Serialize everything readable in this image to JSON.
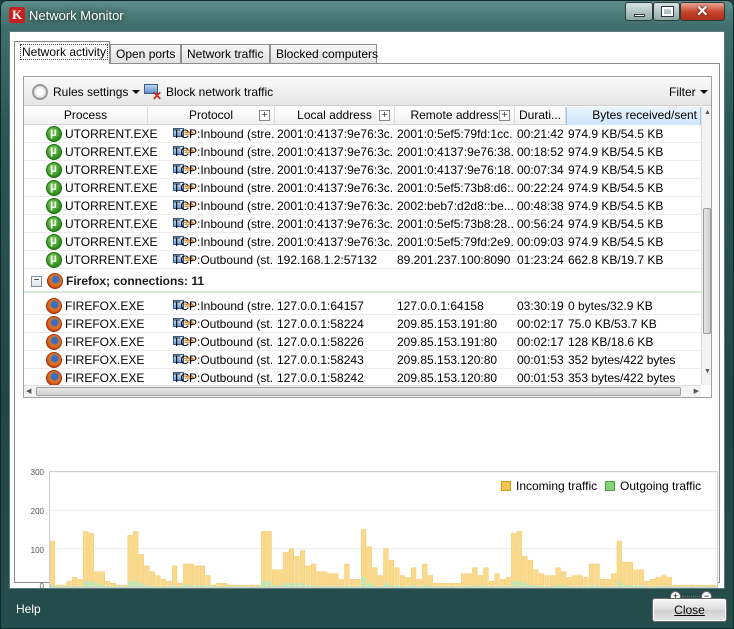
{
  "window": {
    "title": "Network Monitor"
  },
  "tabs": [
    {
      "label": "Network activity",
      "active": true
    },
    {
      "label": "Open ports",
      "active": false
    },
    {
      "label": "Network traffic",
      "active": false
    },
    {
      "label": "Blocked computers",
      "active": false
    }
  ],
  "toolbar": {
    "rules_settings": "Rules settings",
    "block_traffic": "Block network traffic",
    "filter": "Filter"
  },
  "table": {
    "columns": [
      "Process",
      "Protocol",
      "Local address",
      "Remote address",
      "Durati...",
      "Bytes received/sent"
    ],
    "rows_utorrent": [
      {
        "process": "UTORRENT.EXE",
        "protocol": "TCP:Inbound (stre...",
        "local": "2001:0:4137:9e76:3c...",
        "remote": "2001:0:5ef5:79fd:1cc...",
        "duration": "00:21:42",
        "bytes": "974.9 KB/54.5 KB"
      },
      {
        "process": "UTORRENT.EXE",
        "protocol": "TCP:Inbound (stre...",
        "local": "2001:0:4137:9e76:3c...",
        "remote": "2001:0:4137:9e76:38...",
        "duration": "00:18:52",
        "bytes": "974.9 KB/54.5 KB"
      },
      {
        "process": "UTORRENT.EXE",
        "protocol": "TCP:Inbound (stre...",
        "local": "2001:0:4137:9e76:3c...",
        "remote": "2001:0:4137:9e76:18...",
        "duration": "00:07:34",
        "bytes": "974.9 KB/54.5 KB"
      },
      {
        "process": "UTORRENT.EXE",
        "protocol": "TCP:Inbound (stre...",
        "local": "2001:0:4137:9e76:3c...",
        "remote": "2001:0:5ef5:73b8:d6:...",
        "duration": "00:22:24",
        "bytes": "974.9 KB/54.5 KB"
      },
      {
        "process": "UTORRENT.EXE",
        "protocol": "TCP:Inbound (stre...",
        "local": "2001:0:4137:9e76:3c...",
        "remote": "2002:beb7:d2d8::be...",
        "duration": "00:48:38",
        "bytes": "974.9 KB/54.5 KB"
      },
      {
        "process": "UTORRENT.EXE",
        "protocol": "TCP:Inbound (stre...",
        "local": "2001:0:4137:9e76:3c...",
        "remote": "2001:0:5ef5:73b8:28...",
        "duration": "00:56:24",
        "bytes": "974.9 KB/54.5 KB"
      },
      {
        "process": "UTORRENT.EXE",
        "protocol": "TCP:Inbound (stre...",
        "local": "2001:0:4137:9e76:3c...",
        "remote": "2001:0:5ef5:79fd:2e9...",
        "duration": "00:09:03",
        "bytes": "974.9 KB/54.5 KB"
      },
      {
        "process": "UTORRENT.EXE",
        "protocol": "TCP:Outbound (st...",
        "local": "192.168.1.2:57132",
        "remote": "89.201.237.100:8090",
        "duration": "01:23:24",
        "bytes": "662.8 KB/19.7 KB"
      }
    ],
    "group_firefox": "Firefox; connections: 11",
    "rows_firefox": [
      {
        "process": "FIREFOX.EXE",
        "protocol": "TCP:Inbound (stre...",
        "local": "127.0.0.1:64157",
        "remote": "127.0.0.1:64158",
        "duration": "03:30:19",
        "bytes": "0 bytes/32.9 KB"
      },
      {
        "process": "FIREFOX.EXE",
        "protocol": "TCP:Outbound (st...",
        "local": "127.0.0.1:58224",
        "remote": "209.85.153.191:80",
        "duration": "00:02:17",
        "bytes": "75.0 KB/53.7 KB"
      },
      {
        "process": "FIREFOX.EXE",
        "protocol": "TCP:Outbound (st...",
        "local": "127.0.0.1:58226",
        "remote": "209.85.153.191:80",
        "duration": "00:02:17",
        "bytes": "128 KB/18.6 KB"
      },
      {
        "process": "FIREFOX.EXE",
        "protocol": "TCP:Outbound (st...",
        "local": "127.0.0.1:58243",
        "remote": "209.85.153.120:80",
        "duration": "00:01:53",
        "bytes": "352 bytes/422 bytes"
      },
      {
        "process": "FIREFOX.EXE",
        "protocol": "TCP:Outbound (st...",
        "local": "127.0.0.1:58242",
        "remote": "209.85.153.120:80",
        "duration": "00:01:53",
        "bytes": "353 bytes/422 bytes"
      }
    ]
  },
  "chart_data": {
    "type": "bar",
    "yticks": [
      "300",
      "200",
      "100",
      "0"
    ],
    "ylim": [
      0,
      300
    ],
    "series": [
      {
        "name": "Incoming traffic",
        "color": "#f5c451",
        "values": [
          120,
          5,
          5,
          15,
          25,
          20,
          145,
          140,
          40,
          40,
          15,
          10,
          5,
          5,
          135,
          145,
          85,
          55,
          40,
          30,
          20,
          15,
          55,
          10,
          60,
          60,
          55,
          55,
          30,
          5,
          10,
          10,
          5,
          5,
          5,
          5,
          5,
          5,
          145,
          145,
          45,
          45,
          90,
          100,
          80,
          95,
          55,
          60,
          40,
          40,
          35,
          35,
          20,
          60,
          20,
          20,
          150,
          105,
          50,
          30,
          100,
          70,
          50,
          30,
          25,
          50,
          20,
          60,
          30,
          10,
          10,
          10,
          10,
          10,
          35,
          35,
          50,
          30,
          50,
          15,
          35,
          20,
          25,
          140,
          145,
          80,
          70,
          45,
          35,
          30,
          30,
          50,
          40,
          25,
          30,
          30,
          25,
          60,
          60,
          20,
          20,
          35,
          120,
          65,
          65,
          45,
          45,
          15,
          20,
          25,
          30,
          25,
          5,
          5,
          5,
          5,
          5,
          5,
          5,
          5
        ]
      },
      {
        "name": "Outgoing traffic",
        "color": "#86d27a",
        "values": [
          5,
          2,
          2,
          2,
          3,
          3,
          15,
          15,
          10,
          5,
          3,
          2,
          2,
          2,
          15,
          15,
          10,
          5,
          3,
          2,
          2,
          2,
          5,
          2,
          8,
          5,
          5,
          5,
          3,
          2,
          2,
          2,
          2,
          2,
          2,
          2,
          2,
          2,
          15,
          15,
          5,
          5,
          10,
          10,
          10,
          10,
          5,
          5,
          3,
          3,
          3,
          3,
          2,
          5,
          2,
          2,
          25,
          10,
          5,
          3,
          10,
          5,
          5,
          3,
          3,
          5,
          2,
          5,
          3,
          2,
          2,
          2,
          2,
          2,
          3,
          3,
          5,
          3,
          5,
          2,
          3,
          2,
          3,
          15,
          15,
          10,
          5,
          5,
          3,
          3,
          3,
          5,
          5,
          3,
          3,
          3,
          3,
          5,
          5,
          2,
          2,
          3,
          12,
          5,
          5,
          5,
          5,
          2,
          2,
          3,
          3,
          3,
          2,
          2,
          2,
          2,
          2,
          2,
          2,
          2
        ]
      }
    ]
  },
  "footer": {
    "help": "Help",
    "close": "Close"
  }
}
